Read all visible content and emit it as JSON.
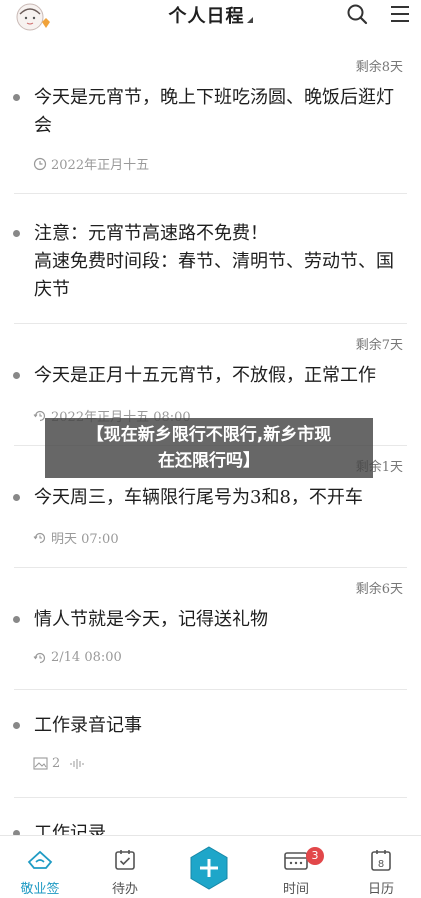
{
  "header": {
    "title": "个人日程",
    "icons": [
      "avatar",
      "search-icon",
      "menu-icon"
    ]
  },
  "items": [
    {
      "remaining": "剩余8天",
      "text": "今天是元宵节，晚上下班吃汤圆、晚饭后逛灯会",
      "meta": "2022年正月十五",
      "meta_icon": "clock-icon"
    },
    {
      "remaining": "",
      "text": "注意：元宵节高速路不免费！\n高速免费时间段：春节、清明节、劳动节、国庆节",
      "meta": "",
      "meta_icon": ""
    },
    {
      "remaining": "剩余7天",
      "text": "今天是正月十五元宵节，不放假，正常工作",
      "meta": "2022年正月十五 08:00",
      "meta_icon": "repeat-clock-icon"
    },
    {
      "remaining": "剩余1天",
      "text": "今天周三，车辆限行尾号为3和8，不开车",
      "meta": "明天 07:00",
      "meta_icon": "repeat-clock-icon"
    },
    {
      "remaining": "剩余6天",
      "text": "情人节就是今天，记得送礼物",
      "meta": "2/14 08:00",
      "meta_icon": "repeat-clock-icon"
    },
    {
      "remaining": "",
      "text": "工作录音记事",
      "meta": "2",
      "meta_icon": "image-icon"
    },
    {
      "remaining": "",
      "text": "工作记录",
      "meta": "",
      "meta_icon": ""
    }
  ],
  "banner": {
    "line1": "【现在新乡限行不限行,新乡市现",
    "line2": "在还限行吗】"
  },
  "nav": {
    "items": [
      {
        "label": "敬业签",
        "icon": "logo-icon",
        "active": true
      },
      {
        "label": "待办",
        "icon": "todo-icon",
        "active": false
      },
      {
        "label": "",
        "icon": "add-icon",
        "active": false
      },
      {
        "label": "时间",
        "icon": "time-icon",
        "active": false,
        "badge": "3"
      },
      {
        "label": "日历",
        "icon": "calendar-icon",
        "active": false
      }
    ]
  },
  "colors": {
    "accent": "#1f9bc4",
    "badge": "#e2474a",
    "text": "#1e1e1e",
    "muted": "#9a9a9a"
  }
}
